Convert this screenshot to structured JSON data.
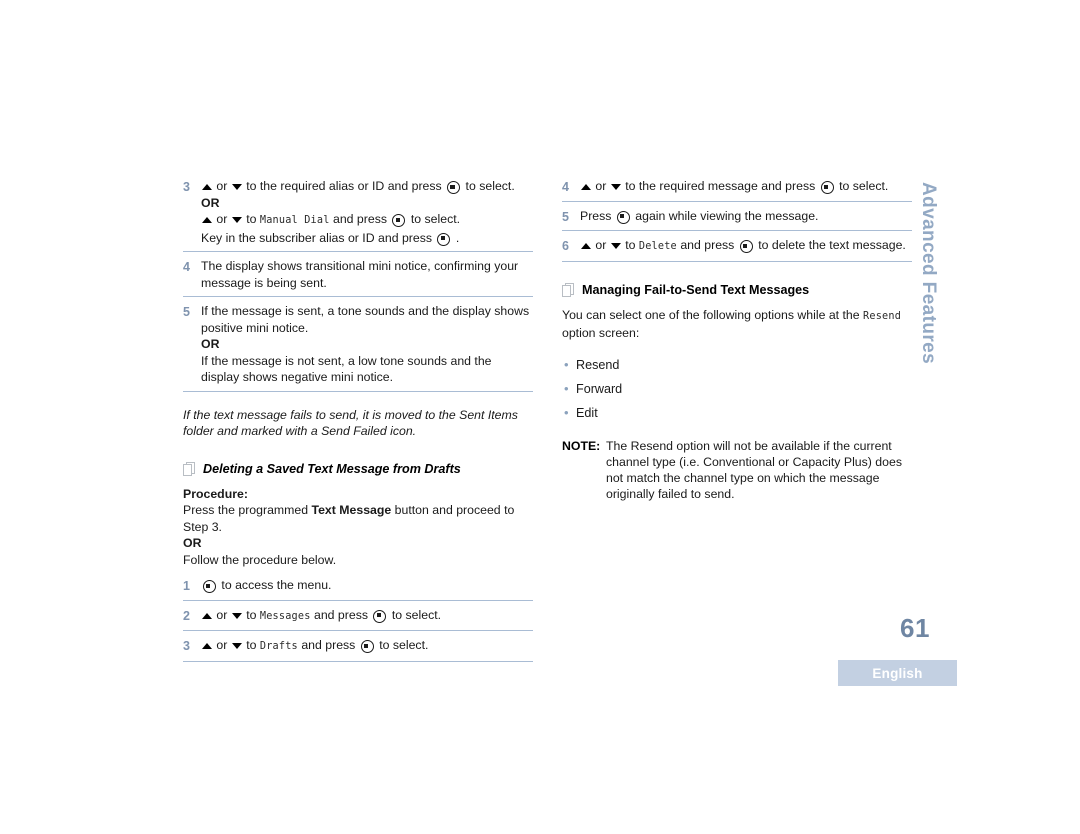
{
  "page": {
    "number": "61",
    "language": "English",
    "side_tab": "Advanced Features"
  },
  "left_column": {
    "step3": {
      "num": "3",
      "line1_a": "or",
      "line1_b": "to the required alias or ID and press",
      "line1_c": "to select.",
      "or": "OR",
      "line2_a": "or",
      "line2_b": "to",
      "line2_mono": "Manual  Dial",
      "line2_c": "and press",
      "line2_d": "to select.",
      "line3_a": "Key in the subscriber alias or ID and press",
      "line3_b": "."
    },
    "step4": {
      "num": "4",
      "text": "The display shows transitional mini notice, confirming your message is being sent."
    },
    "step5": {
      "num": "5",
      "line1": "If the message is sent, a tone sounds and the display shows positive mini notice.",
      "or": "OR",
      "line2": "If the message is not sent, a low tone sounds and the display shows negative mini notice."
    },
    "italic_note": "If the text message fails to send, it is moved to the Sent Items folder and marked with a Send Failed icon.",
    "section": {
      "title": "Deleting a Saved Text Message from Drafts",
      "procedure_label": "Procedure:",
      "intro_a": "Press the programmed",
      "intro_bold": "Text Message",
      "intro_b": "button and proceed to Step 3.",
      "or": "OR",
      "follow": "Follow the procedure below."
    },
    "sub_steps": [
      {
        "num": "1",
        "text": "to access the menu."
      },
      {
        "num": "2",
        "a": "or",
        "b": "to",
        "mono": "Messages",
        "c": "and press",
        "d": "to select."
      },
      {
        "num": "3",
        "a": "or",
        "b": "to",
        "mono": "Drafts",
        "c": "and press",
        "d": "to select."
      }
    ]
  },
  "right_column": {
    "step4": {
      "num": "4",
      "a": "or",
      "b": "to the required message and press",
      "c": "to select."
    },
    "step5": {
      "num": "5",
      "a": "Press",
      "b": "again while viewing the message."
    },
    "step6": {
      "num": "6",
      "a": "or",
      "b": "to",
      "mono": "Delete",
      "c": "and press",
      "d": "to delete the text message."
    },
    "section": {
      "title": "Managing Fail-to-Send Text Messages",
      "intro_a": "You can select one of the following options while at the",
      "intro_mono": "Resend",
      "intro_b": "option screen:"
    },
    "options": [
      "Resend",
      "Forward",
      "Edit"
    ],
    "note": {
      "label": "NOTE:",
      "text": "The Resend option will not be available if the current channel type (i.e. Conventional or Capacity Plus) does not match the channel type on which the message originally failed to send."
    }
  },
  "colors": {
    "rule": "#a9bcd4",
    "step_number": "#7f93ae",
    "side_tab": "#93a9c4",
    "page_number": "#6f86a3",
    "lang_bar_bg": "#c3d0e2",
    "bullet": "#8ba2bd"
  },
  "icons": {
    "arrow_up": "arrow-up-icon",
    "arrow_down": "arrow-down-icon",
    "menu_button": "menu-select-button-icon",
    "section": "page-section-icon"
  }
}
